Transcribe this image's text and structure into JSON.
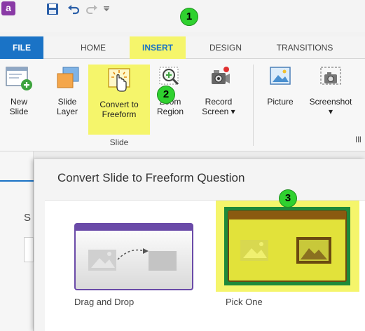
{
  "app": {
    "logo_glyph": "a"
  },
  "steps": [
    "1",
    "2",
    "3"
  ],
  "tabs": [
    "FILE",
    "HOME",
    "INSERT",
    "DESIGN",
    "TRANSITIONS"
  ],
  "ribbon": {
    "new_slide": [
      "New",
      "Slide"
    ],
    "slide_layer": [
      "Slide",
      "Layer"
    ],
    "convert": [
      "Convert to",
      "Freeform"
    ],
    "zoom_region": [
      "Zoom",
      "Region"
    ],
    "record_screen": [
      "Record",
      "Screen ▾"
    ],
    "picture": "Picture",
    "screenshot": "Screenshot",
    "screenshot_caret": "▾",
    "group_slide": "Slide",
    "group_more": "Ill"
  },
  "dialog": {
    "title": "Convert Slide to Freeform Question",
    "background_letter": "S",
    "options": [
      "Drag and Drop",
      "Pick One"
    ]
  },
  "colors": {
    "highlight": "#f5f56b",
    "accent": "#1a73c6",
    "badge": "#2fd12f",
    "brand": "#8a3aa6"
  }
}
